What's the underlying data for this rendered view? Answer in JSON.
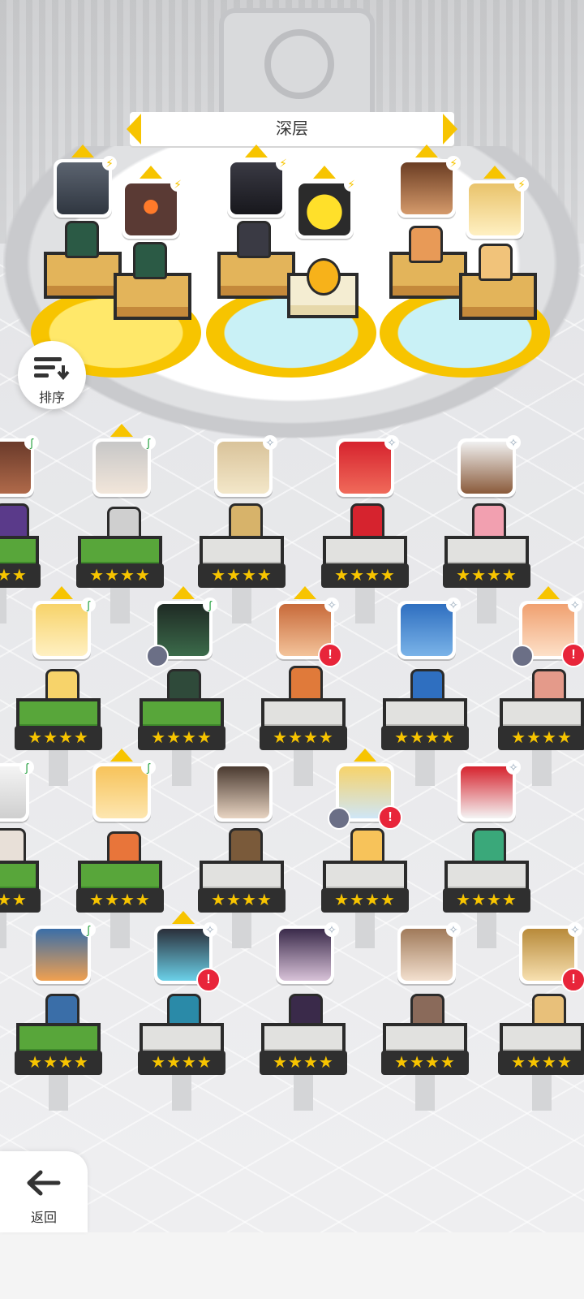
{
  "header": {
    "title": "深层"
  },
  "controls": {
    "sort_label": "排序",
    "back_label": "返回"
  },
  "rating": {
    "four_star_label": "★★★★"
  },
  "colors": {
    "accent": "#f7c400",
    "alert": "#e8253a",
    "grass": "#58a63a",
    "stone": "#e1e1df"
  },
  "icons": {
    "sort": "sort-icon",
    "back": "back-arrow-icon",
    "alert": "alert-icon",
    "class": "class-icon"
  }
}
